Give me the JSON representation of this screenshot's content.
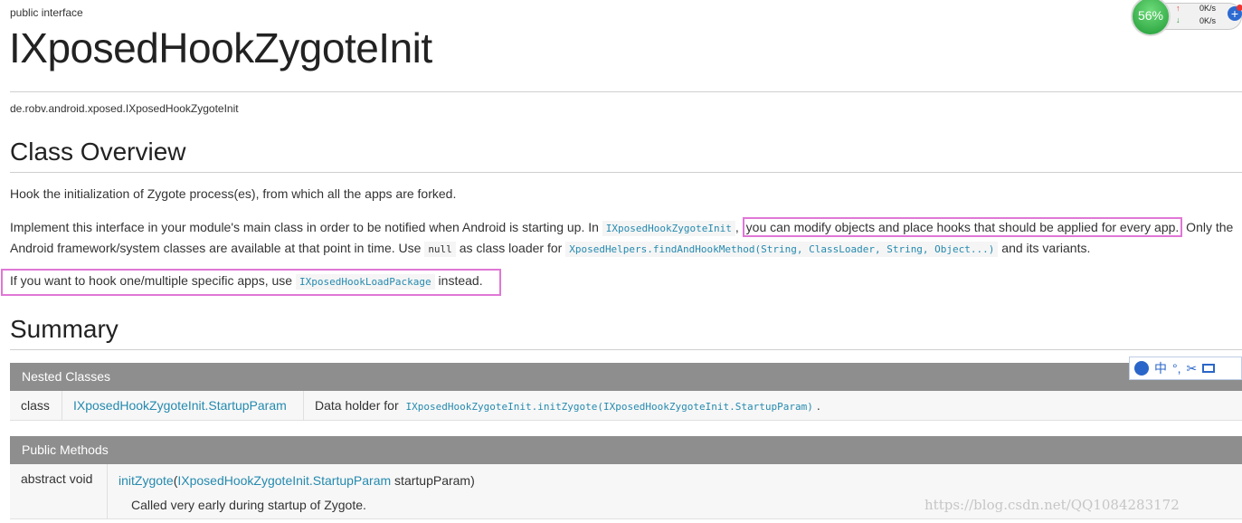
{
  "header": {
    "kind": "public interface",
    "title": "IXposedHookZygoteInit",
    "package": "de.robv.android.xposed.IXposedHookZygoteInit"
  },
  "overview": {
    "heading": "Class Overview",
    "p1": "Hook the initialization of Zygote process(es), from which all the apps are forked.",
    "p2_a": "Implement this interface in your module's main class in order to be notified when Android is starting up. In ",
    "p2_code1": "IXposedHookZygoteInit",
    "p2_b": ", ",
    "p2_highlight": "you can modify objects and place hooks that should be applied for every app.",
    "p2_c": " Only the",
    "p2_d": "Android framework/system classes are available at that point in time. Use ",
    "p2_code2": "null",
    "p2_e": " as class loader for ",
    "p2_code3": "XposedHelpers.findAndHookMethod(String, ClassLoader, String, Object...)",
    "p2_f": " and its variants.",
    "p3_a": "If you want to hook one/multiple specific apps, use ",
    "p3_code": "IXposedHookLoadPackage",
    "p3_b": " instead."
  },
  "summary": {
    "heading": "Summary",
    "nested": {
      "header": "Nested Classes",
      "rows": [
        {
          "kind": "class",
          "name": "IXposedHookZygoteInit.StartupParam",
          "desc_prefix": "Data holder for ",
          "desc_code": "IXposedHookZygoteInit.initZygote(IXposedHookZygoteInit.StartupParam)",
          "desc_suffix": "."
        }
      ]
    },
    "methods": {
      "header": "Public Methods",
      "rows": [
        {
          "modifier": "abstract void",
          "name": "initZygote",
          "open": "(",
          "param_type": "IXposedHookZygoteInit.StartupParam",
          "param_name": " startupParam)",
          "desc": "Called very early during startup of Zygote."
        }
      ]
    }
  },
  "widget": {
    "percent": "56%",
    "up": "0K/s",
    "down": "0K/s",
    "plus": "+",
    "up_arrow": "↑",
    "down_arrow": "↓"
  },
  "ime": {
    "chinese": "中",
    "punct": "°,"
  },
  "watermark": "https://blog.csdn.net/QQ1084283172",
  "colors": {
    "link": "#258aaf",
    "highlight_border": "#e077d6",
    "table_header": "#8e8e8e",
    "widget_green": "#1f9b35"
  }
}
